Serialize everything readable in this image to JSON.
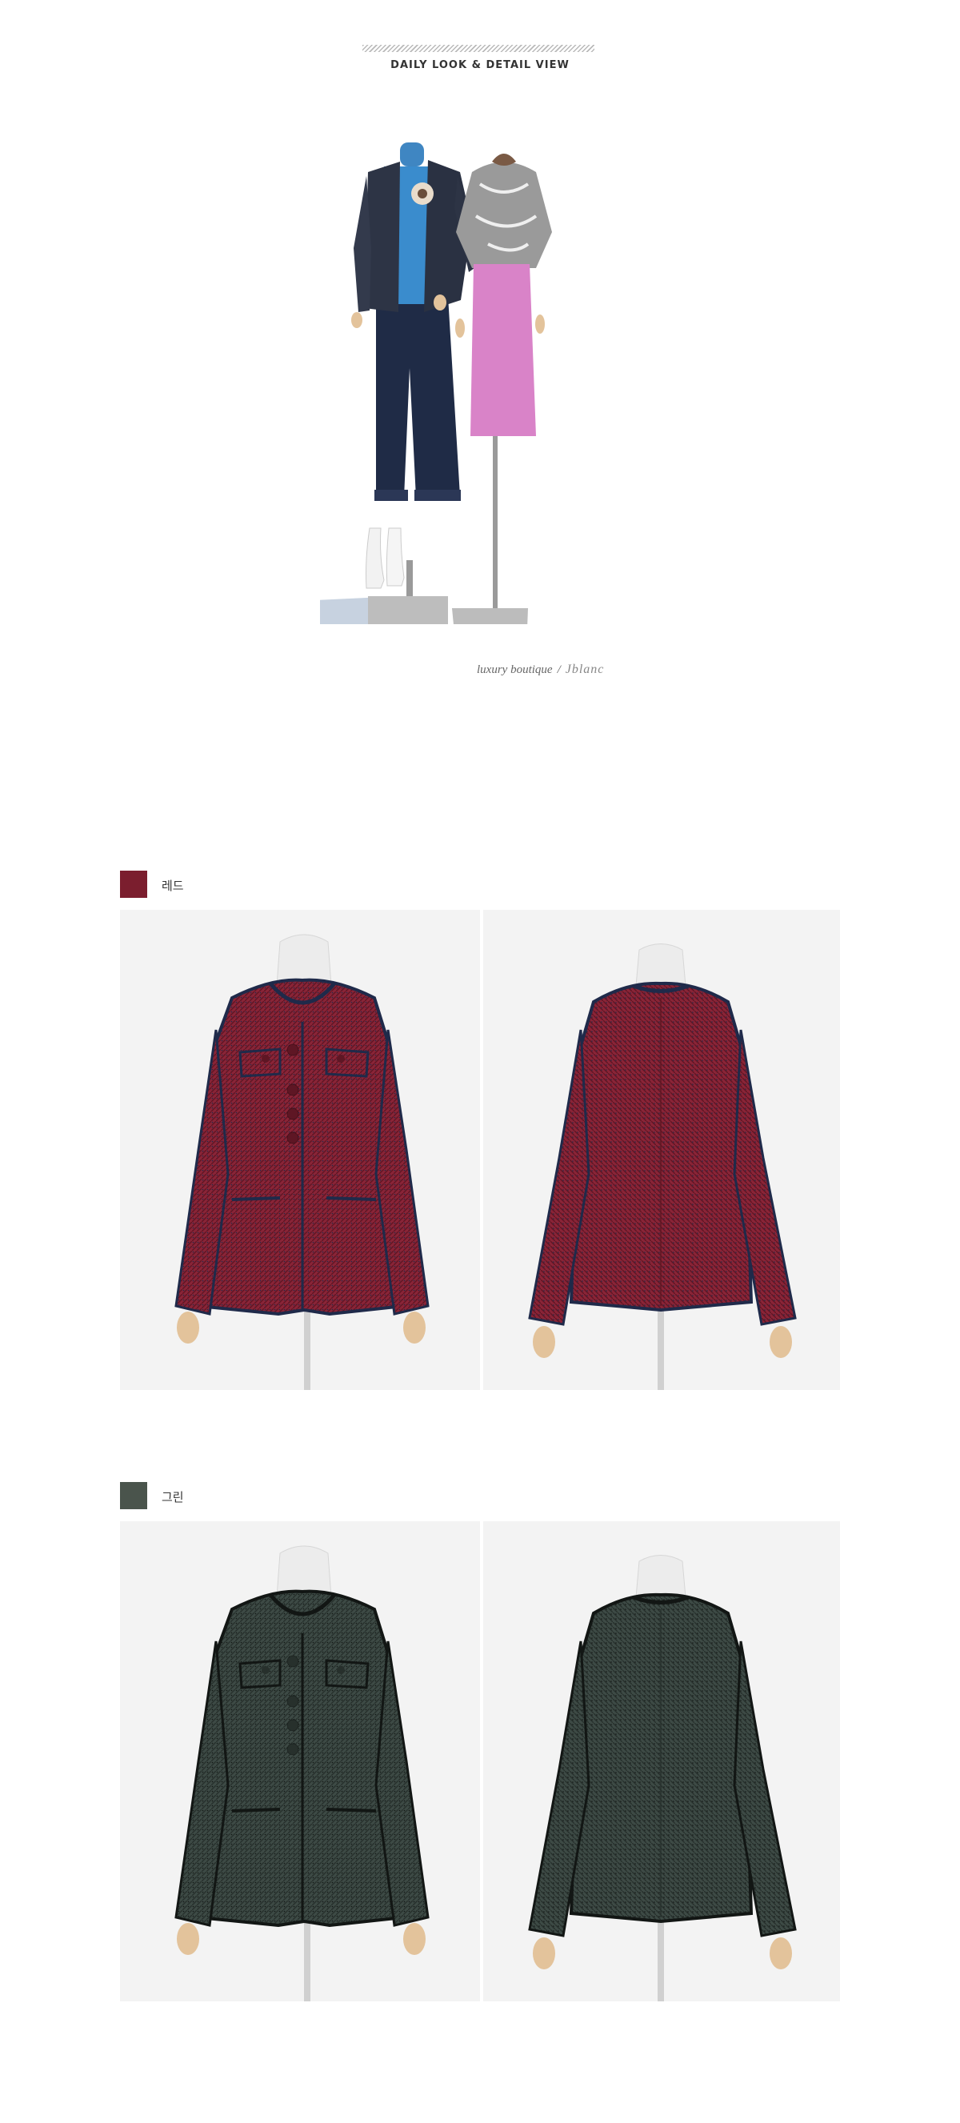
{
  "header": {
    "title": "DAILY LOOK & DETAIL VIEW"
  },
  "hero": {
    "icon": "mannequin-lookbook-image",
    "brand_tagline": "luxury boutique",
    "separator": "/",
    "brand_signature": "Jblanc"
  },
  "colors": [
    {
      "label": "레드",
      "swatch": "#7b1e2e",
      "body": "#8a2437",
      "body_dark": "#5e1624",
      "trim": "#1f2a4a"
    },
    {
      "label": "그린",
      "swatch": "#4a544c",
      "body": "#3d4a45",
      "body_dark": "#27302c",
      "trim": "#121614"
    }
  ]
}
